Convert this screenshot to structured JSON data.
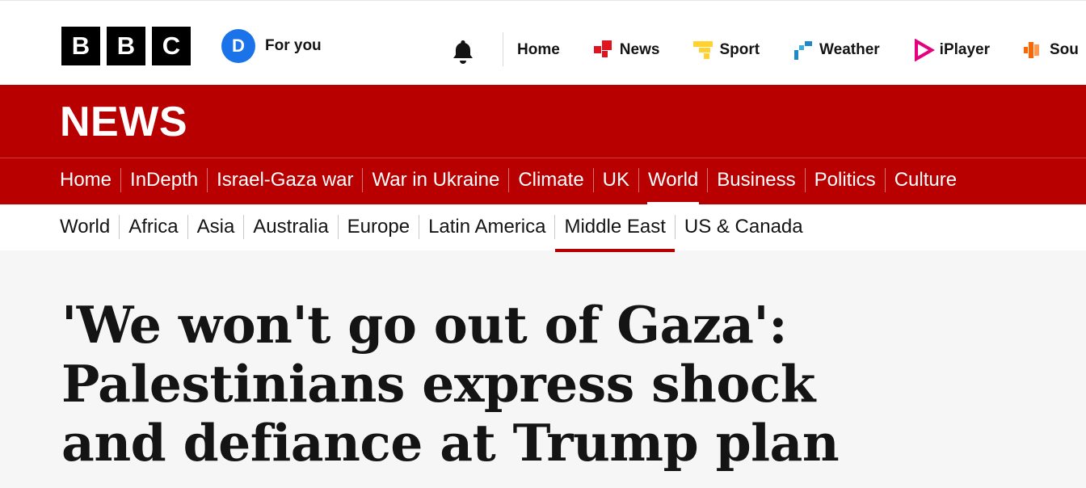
{
  "brand": {
    "letters": [
      "B",
      "B",
      "C"
    ]
  },
  "account": {
    "initial": "D",
    "label": "For you"
  },
  "topnav": [
    {
      "label": "Home",
      "icon": "none"
    },
    {
      "label": "News",
      "icon": "news-icon",
      "color": "#e0141e"
    },
    {
      "label": "Sport",
      "icon": "sport-icon",
      "color": "#ffd230"
    },
    {
      "label": "Weather",
      "icon": "weather-icon",
      "color": "#1e88c9"
    },
    {
      "label": "iPlayer",
      "icon": "iplayer-icon",
      "color": "#e6007e"
    },
    {
      "label": "Sou",
      "icon": "sounds-icon",
      "color": "#ff6600"
    }
  ],
  "masthead": {
    "title": "NEWS"
  },
  "sections": [
    "Home",
    "InDepth",
    "Israel-Gaza war",
    "War in Ukraine",
    "Climate",
    "UK",
    "World",
    "Business",
    "Politics",
    "Culture"
  ],
  "sections_active": "World",
  "subsections": [
    "World",
    "Africa",
    "Asia",
    "Australia",
    "Europe",
    "Latin America",
    "Middle East",
    "US & Canada"
  ],
  "subsections_active": "Middle East",
  "article": {
    "headline": "'We won't go out of Gaza': Palestinians express shock and defiance at Trump plan"
  },
  "colors": {
    "brand_red": "#b80000",
    "avatar_blue": "#1a73e8"
  }
}
